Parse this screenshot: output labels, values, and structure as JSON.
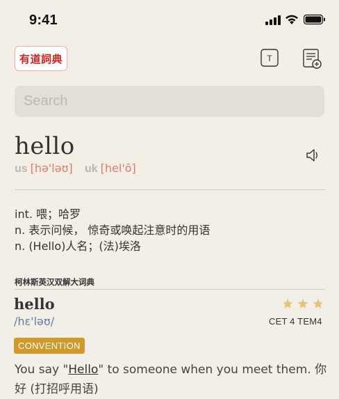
{
  "status_bar": {
    "time": "9:41"
  },
  "header": {
    "logo_text": "有道詞典",
    "icons": [
      "font-size-icon",
      "wordbook-add-icon"
    ],
    "t_icon_letter": "T"
  },
  "search": {
    "placeholder": "Search",
    "value": ""
  },
  "entry": {
    "word": "hello",
    "us_label": "us",
    "us_ipa": "[hə'ləʊ]",
    "uk_label": "uk",
    "uk_ipa": "[hel'ō]",
    "definitions": [
      "int. 喂；哈罗",
      "n. 表示问候， 惊奇或唤起注意时的用语",
      "n. (Hello)人名；(法)埃洛"
    ]
  },
  "collins": {
    "title": "柯林斯英汉双解大词典",
    "word": "hello",
    "ipa": "/hɛ'ləʊ/",
    "stars": 3,
    "levels": "CET 4 TEM4",
    "badge": "CONVENTION",
    "example_pre": "You say \"",
    "example_word": "Hello",
    "example_post": "\" to someone when you meet them. 你好 (打招呼用语)"
  },
  "colors": {
    "accent_red": "#d42121",
    "star": "#e8c274",
    "badge": "#cf9a2b",
    "ipa": "#e07a6b"
  }
}
